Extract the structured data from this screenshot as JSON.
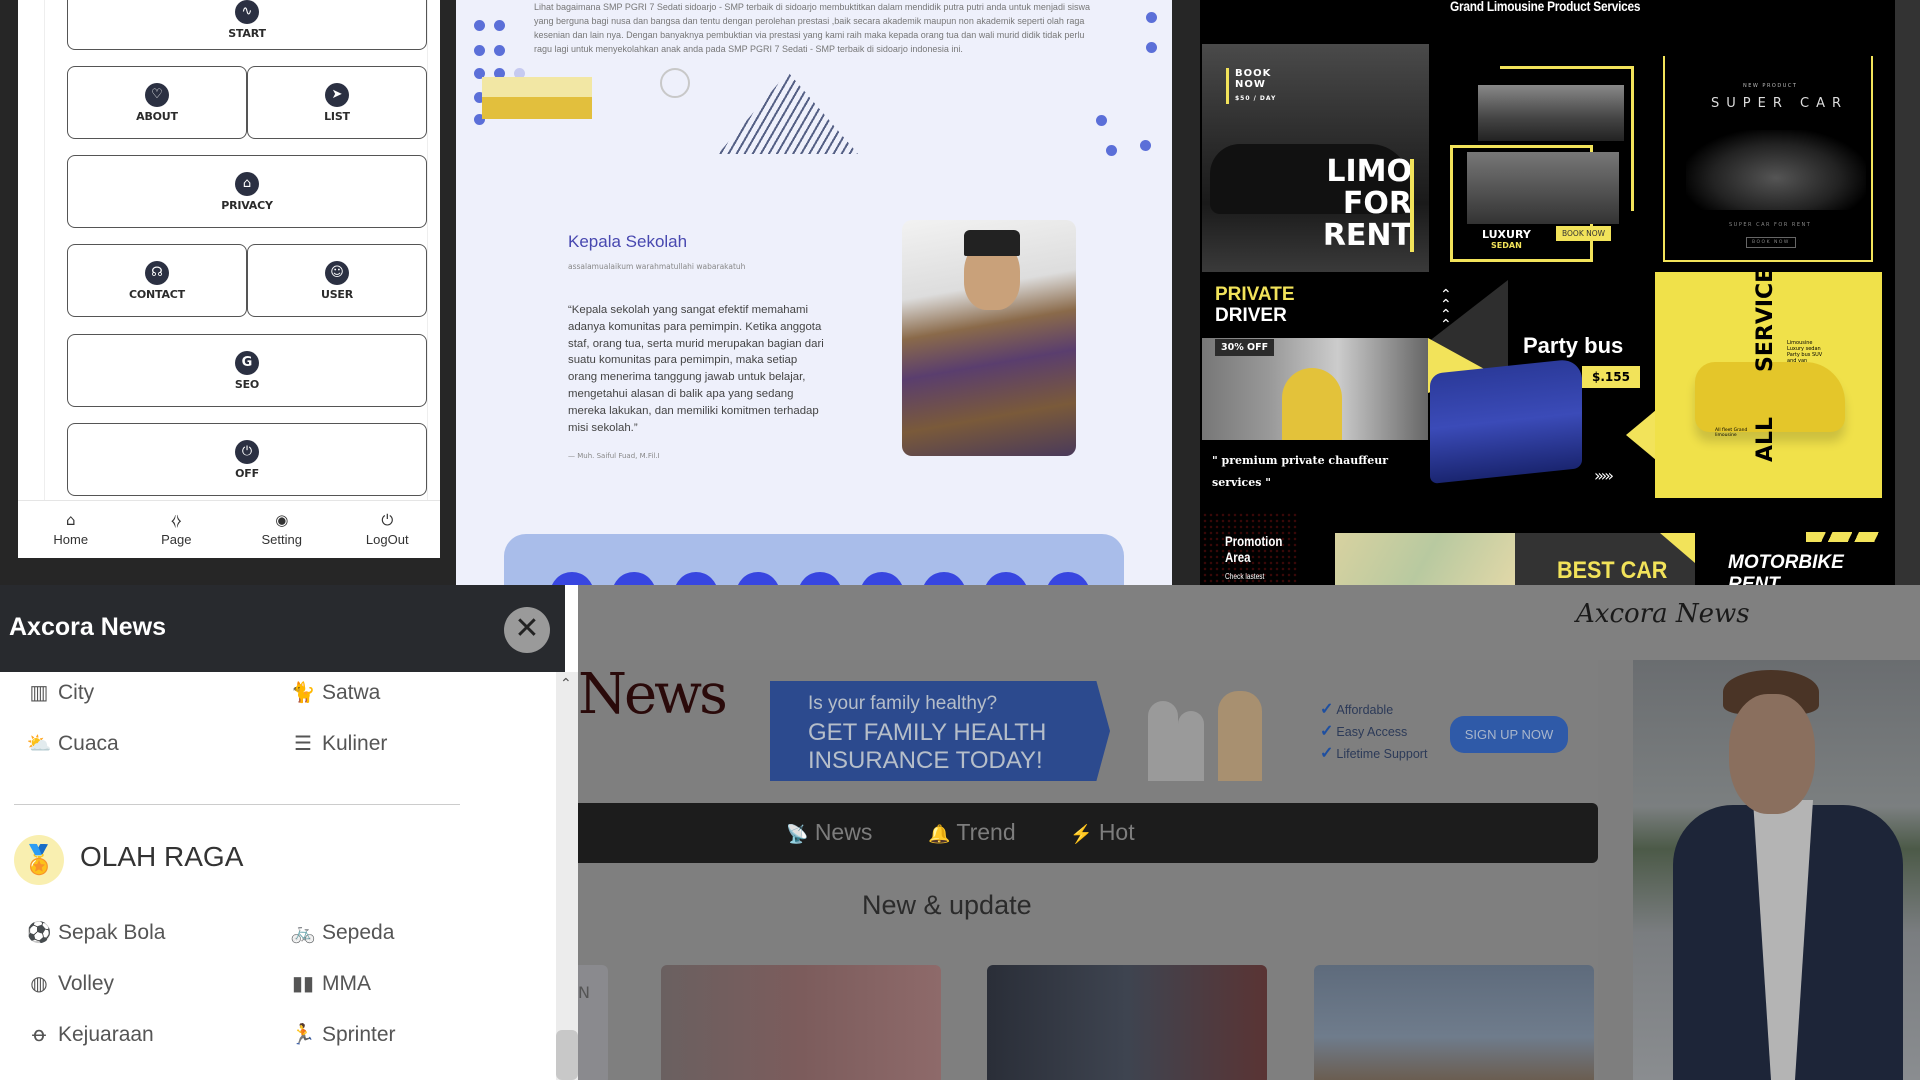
{
  "phone_app": {
    "buttons": [
      {
        "label": "START",
        "icon": "pulse-icon"
      },
      {
        "label": "ABOUT",
        "icon": "heart-arrow-icon"
      },
      {
        "label": "LIST",
        "icon": "send-icon"
      },
      {
        "label": "PRIVACY",
        "icon": "usb-icon"
      },
      {
        "label": "CONTACT",
        "icon": "headset-icon"
      },
      {
        "label": "USER",
        "icon": "user-circle-icon"
      },
      {
        "label": "SEO",
        "icon": "google-icon"
      },
      {
        "label": "OFF",
        "icon": "power-icon"
      }
    ],
    "nav": [
      {
        "label": "Home",
        "icon": "home-icon"
      },
      {
        "label": "Page",
        "icon": "code-icon"
      },
      {
        "label": "Setting",
        "icon": "settings-icon"
      },
      {
        "label": "LogOut",
        "icon": "power-icon"
      }
    ]
  },
  "school": {
    "intro": "Lihat bagaimana SMP PGRI 7 Sedati sidoarjo - SMP terbaik di sidoarjo membuktitkan dalam mendidik putra putri anda untuk menjadi siswa yang berguna bagi nusa dan bangsa dan tentu dengan perolehan prestasi ,baik secara akademik maupun non akademik seperti olah raga kesenian dan lain nya. Dengan banyaknya pembuktian via prestasi yang kami raih maka kepada orang tua dan wali murid didik tidak perlu ragu lagi untuk menyekolahkan anak anda pada SMP PGRI 7 Sedati - SMP terbaik di sidoarjo indonesia ini.",
    "kepala_title": "Kepala Sekolah",
    "salam": "assalamualaikum warahmatullahi wabarakatuh",
    "quote": "“Kepala sekolah yang sangat efektif memahami adanya komunitas para pemimpin. Ketika anggota staf, orang tua, serta murid merupakan bagian dari suatu komunitas para pemimpin, maka setiap orang menerima tanggung jawab untuk belajar, mengetahui alasan di balik apa yang sedang mereka lakukan, dan memiliki komitmen terhadap misi sekolah.”",
    "author": "— Muh. Saiful Fuad, M.Fil.I",
    "colors": {
      "accent": "#4848b0",
      "dots": "#5b6fd8",
      "iconbar": "#a9bdea"
    }
  },
  "limo": {
    "title": "Grand Limousine Product Services",
    "book_now": "BOOK NOW",
    "per_day": "$50 / DAY",
    "limo_for_rent": [
      "LIMO",
      "FOR",
      "RENT"
    ],
    "luxury": "LUXURY",
    "sedan": "SEDAN",
    "book_now_btn": "BOOK NOW",
    "new_product": "NEW PRODUCT",
    "super_car": "SUPER CAR",
    "super_car_for_rent": "SUPER CAR FOR RENT",
    "book_now_small": "BOOK NOW",
    "private": "PRIVATE",
    "driver": "DRIVER",
    "discount": "30% OFF",
    "chauffeur": "\" premium private chauffeur services \"",
    "party_bus": "Party bus",
    "party_bus_price": "$.155",
    "chevrons_up": "︿︿︿︿",
    "chevrons_right": "›››››",
    "all": "ALL",
    "service": "SERVICE",
    "service_list": "Limousine Luxury sedan Party bus SUV and van",
    "all_fleet": "All fleet Grand limousine",
    "promotion": "Promotion Area",
    "check_latest": "Check lastest",
    "best_car": "BEST CAR",
    "motorbike": "MOTORBIKE RENT",
    "colors": {
      "yellow": "#f2e35a",
      "bg": "#000000"
    }
  },
  "news_menu": {
    "title": "Axcora News",
    "close_icon": "×",
    "categories": [
      {
        "label": "City",
        "icon": "city-icon",
        "glyph": "▥"
      },
      {
        "label": "Satwa",
        "icon": "cat-icon",
        "glyph": "🐈"
      },
      {
        "label": "Cuaca",
        "icon": "weather-icon",
        "glyph": "⛅"
      },
      {
        "label": "Kuliner",
        "icon": "burger-icon",
        "glyph": "☰"
      }
    ],
    "section_title": "OLAH RAGA",
    "section_icon": "🏅",
    "sports": [
      {
        "label": "Sepak Bola",
        "icon": "soccer-ball-icon",
        "glyph": "⚽"
      },
      {
        "label": "Sepeda",
        "icon": "bicycle-icon",
        "glyph": "🚲"
      },
      {
        "label": "Volley",
        "icon": "volleyball-icon",
        "glyph": "◍"
      },
      {
        "label": "MMA",
        "icon": "dumbbell-icon",
        "glyph": "▮▮"
      },
      {
        "label": "Kejuaraan",
        "icon": "medal-icon",
        "glyph": "ꝋ"
      },
      {
        "label": "Sprinter",
        "icon": "runner-icon",
        "glyph": "🏃"
      }
    ]
  },
  "news_site": {
    "brand": "Axcora News",
    "logo_partial": "News",
    "ad": {
      "question": "Is your family healthy?",
      "headline": "GET FAMILY HEALTH INSURANCE TODAY!",
      "checks": [
        "Affordable",
        "Easy Access",
        "Lifetime Support"
      ],
      "cta": "SIGN UP NOW"
    },
    "nav": [
      {
        "label": "News",
        "icon": "satellite-icon",
        "glyph": "📡"
      },
      {
        "label": "Trend",
        "icon": "bell-icon",
        "glyph": "🔔"
      },
      {
        "label": "Hot",
        "icon": "bolt-icon",
        "glyph": "⚡"
      }
    ],
    "section_title": "New & update",
    "partial_letter": "N"
  }
}
